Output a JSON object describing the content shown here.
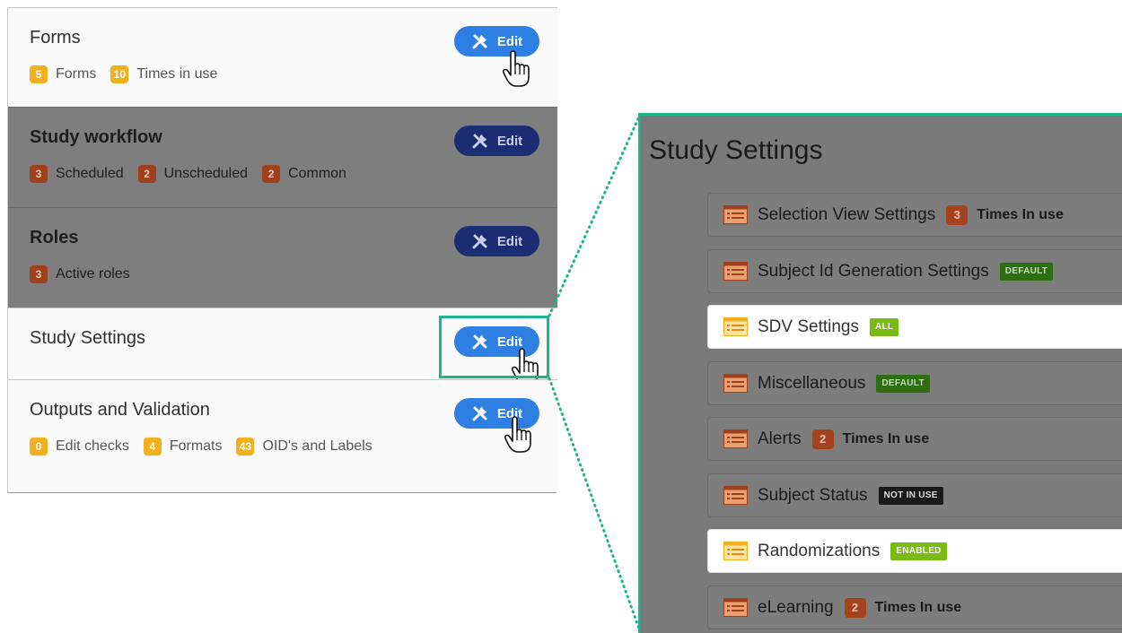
{
  "sections": [
    {
      "title": "Forms",
      "edit_label": "Edit",
      "stats": [
        {
          "count": "5",
          "label": "Forms"
        },
        {
          "count": "10",
          "label": "Times in use"
        }
      ]
    },
    {
      "title": "Study workflow",
      "edit_label": "Edit",
      "stats": [
        {
          "count": "3",
          "label": "Scheduled"
        },
        {
          "count": "2",
          "label": "Unscheduled"
        },
        {
          "count": "2",
          "label": "Common"
        }
      ]
    },
    {
      "title": "Roles",
      "edit_label": "Edit",
      "stats": [
        {
          "count": "3",
          "label": "Active roles"
        }
      ]
    },
    {
      "title": "Study Settings",
      "edit_label": "Edit",
      "stats": []
    },
    {
      "title": "Outputs and Validation",
      "edit_label": "Edit",
      "stats": [
        {
          "count": "0",
          "label": "Edit checks"
        },
        {
          "count": "4",
          "label": "Formats"
        },
        {
          "count": "43",
          "label": "OID's and Labels"
        }
      ]
    }
  ],
  "zoom": {
    "title": "Study Settings",
    "rows": [
      {
        "label": "Selection View Settings",
        "count": "3",
        "count_label": "Times In use"
      },
      {
        "label": "Subject Id Generation Settings",
        "tag": "DEFAULT"
      },
      {
        "label": "SDV Settings",
        "tag": "ALL"
      },
      {
        "label": "Miscellaneous",
        "tag": "DEFAULT"
      },
      {
        "label": "Alerts",
        "count": "2",
        "count_label": "Times In use"
      },
      {
        "label": "Subject Status",
        "tag": "NOT IN USE"
      },
      {
        "label": "Randomizations",
        "tag": "ENABLED"
      },
      {
        "label": "eLearning",
        "count": "2",
        "count_label": "Times In use"
      }
    ]
  },
  "colors": {
    "accent": "#2e7fe3",
    "highlight": "#1fb58a",
    "badge_yellow": "#f2b01e",
    "badge_brown": "#a0401d"
  },
  "icons": [
    "tools-icon",
    "pointer-hand-icon",
    "settings-list-icon"
  ]
}
